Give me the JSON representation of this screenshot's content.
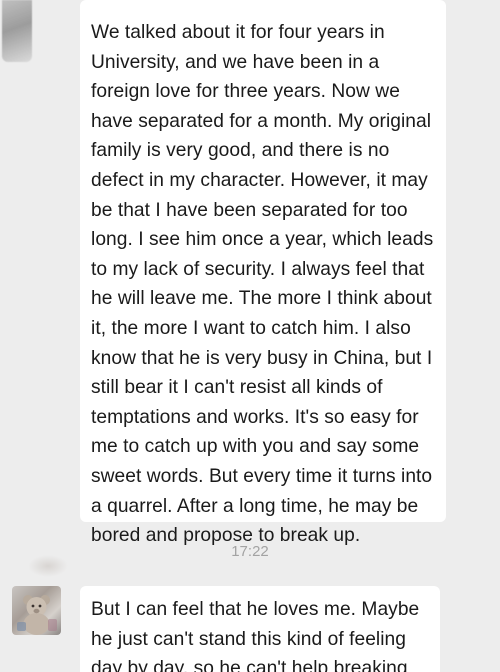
{
  "messages": [
    {
      "lines": [
        "We talked about it for four years in",
        "University, and we have been in a",
        "foreign love for three years. Now we",
        "have separated for a month. My original",
        "family is very good, and there is no",
        "defect in my character. However, it may",
        "be that I have been separated for too",
        "long. I see him once a year, which leads",
        "to my lack of security. I always feel that",
        "he will leave me. The more I think about",
        "it, the more I want to catch him. I also",
        "know that he is very busy in China, but I",
        "still bear it I can't resist all kinds of",
        "temptations and works. It's so easy for",
        "me to catch up with you and say some",
        "sweet words. But every time it turns into",
        "a quarrel. After a long time, he may be",
        "bored and propose to break up."
      ]
    },
    {
      "lines": [
        "But I can feel that he loves me. Maybe",
        "he just can't stand this kind of feeling",
        "day by day, so he can't help breaking"
      ]
    }
  ],
  "timestamp": "17:22",
  "avatar": {
    "icon": "teddy-bear-photo"
  }
}
